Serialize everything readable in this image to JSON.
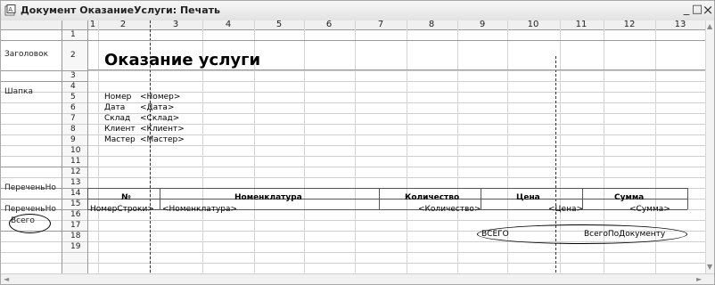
{
  "window": {
    "title": "Документ ОказаниеУслуги: Печать",
    "minimize": "_",
    "restore": "□",
    "close": "×"
  },
  "columns": [
    "1",
    "2",
    "3",
    "4",
    "5",
    "6",
    "7",
    "8",
    "9",
    "10",
    "11",
    "12",
    "13"
  ],
  "rows": [
    "1",
    "2",
    "3",
    "4",
    "5",
    "6",
    "7",
    "8",
    "9",
    "10",
    "11",
    "12",
    "13",
    "14",
    "15",
    "16",
    "17",
    "18",
    "19"
  ],
  "sections": {
    "zagolovok": "Заголовок",
    "shapka": "Шапка",
    "perechen1": "ПереченьНо",
    "perechen2": "ПереченьНо",
    "vsego": "Всего"
  },
  "document": {
    "title": "Оказание услуги",
    "fields": [
      {
        "label": "Номер",
        "value": "<Номер>"
      },
      {
        "label": "Дата",
        "value": "<Дата>"
      },
      {
        "label": "Склад",
        "value": "<Склад>"
      },
      {
        "label": "Клиент",
        "value": "<Клиент>"
      },
      {
        "label": "Мастер",
        "value": "<Мастер>"
      }
    ],
    "table_header": {
      "num": "№",
      "nomenclature": "Номенклатура",
      "quantity": "Количество",
      "price": "Цена",
      "sum": "Сумма"
    },
    "table_row": {
      "num": "НомерСтроки>",
      "nomenclature": "<Номенклатура>",
      "quantity": "<Количество>",
      "price": "<Цена>",
      "sum": "<Сумма>"
    },
    "total": {
      "label": "ВСЕГО",
      "value": "ВсегоПоДокументу"
    }
  }
}
